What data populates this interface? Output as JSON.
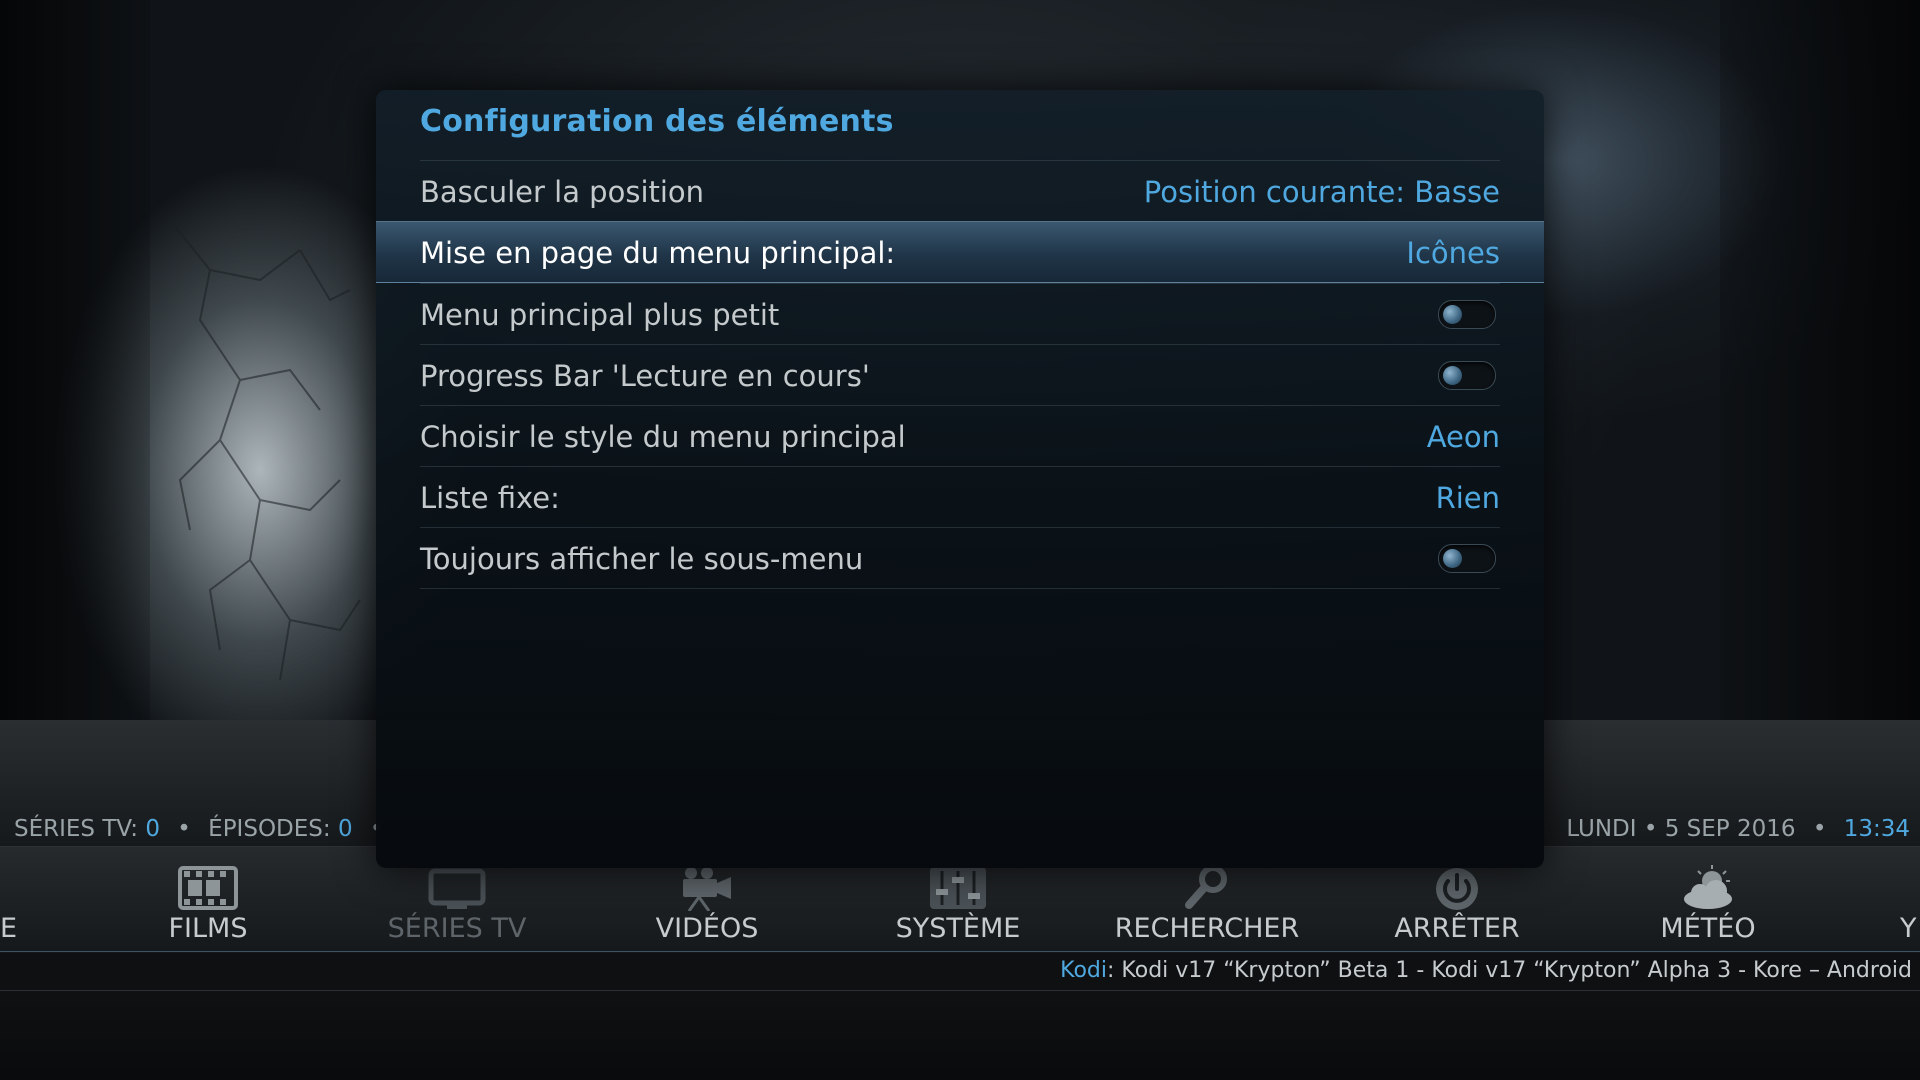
{
  "dialog": {
    "title": "Configuration des éléments",
    "rows": [
      {
        "label": "Basculer la position",
        "value": "Position courante: Basse"
      },
      {
        "label": "Mise en page du menu principal:",
        "value": "Icônes"
      },
      {
        "label": "Menu principal plus petit",
        "toggle": false
      },
      {
        "label": "Progress Bar 'Lecture en cours'",
        "toggle": false
      },
      {
        "label": "Choisir le style du menu principal",
        "value": "Aeon"
      },
      {
        "label": "Liste fixe:",
        "value": "Rien"
      },
      {
        "label": "Toujours afficher le sous-menu",
        "toggle": false
      }
    ]
  },
  "status": {
    "series_label": "SÉRIES TV:",
    "series_count": "0",
    "episodes_label": "ÉPISODES:",
    "episodes_count": "0",
    "date": "LUNDI • 5 SEP 2016",
    "time": "13:34"
  },
  "menu": {
    "edge_left": "E",
    "edge_right": "Y",
    "items": [
      {
        "label": "FILMS",
        "icon": "film-icon"
      },
      {
        "label": "SÉRIES TV",
        "icon": "tv-icon"
      },
      {
        "label": "VIDÉOS",
        "icon": "video-camera-icon"
      },
      {
        "label": "SYSTÈME",
        "icon": "sliders-icon"
      },
      {
        "label": "RECHERCHER",
        "icon": "search-icon"
      },
      {
        "label": "ARRÊTER",
        "icon": "power-icon"
      },
      {
        "label": "MÉTÉO",
        "icon": "weather-icon"
      }
    ]
  },
  "ticker": {
    "source": "Kodi",
    "text": ": Kodi v17 “Krypton” Beta 1 - Kodi v17 “Krypton” Alpha 3 - Kore – Android"
  },
  "colors": {
    "accent": "#4fa8df",
    "text": "#c4c9cc",
    "selected_row": "#2a4558"
  }
}
